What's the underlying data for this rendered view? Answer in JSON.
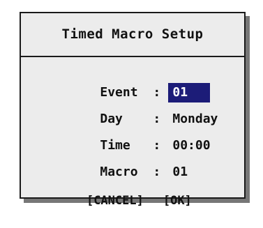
{
  "dialog": {
    "title": "Timed Macro Setup",
    "fields": [
      {
        "label": "Event",
        "separator": ":",
        "value": "01",
        "selected": true
      },
      {
        "label": "Day",
        "separator": ":",
        "value": "Monday",
        "selected": false
      },
      {
        "label": "Time",
        "separator": ":",
        "value": "00:00",
        "selected": false
      },
      {
        "label": "Macro",
        "separator": ":",
        "value": "01",
        "selected": false
      }
    ],
    "buttons": {
      "cancel": "[CANCEL]",
      "ok": "[OK]"
    }
  },
  "colors": {
    "selection_background": "#1c1c78",
    "selection_text": "#ffffff",
    "dialog_background": "#ececec",
    "border": "#1a1a1a"
  }
}
